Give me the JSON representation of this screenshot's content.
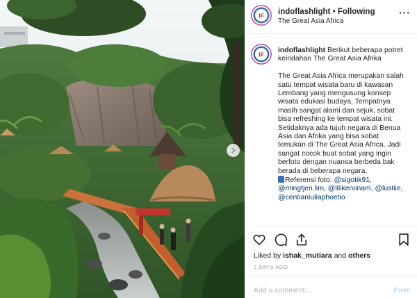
{
  "post": {
    "username": "indoflashlight",
    "separator": "•",
    "follow_label": "Following",
    "location": "The Great Asia Africa",
    "more_label": "···"
  },
  "caption": {
    "username": "indoflashlight",
    "intro": "Berikut beberapa potret keindahan The Great Asia Afrika",
    "body_text": "The Great Asia Africa merupakan salah satu tempat wisata baru di kawasan Lembang yang mengusung konsep wisata edukasi budaya. Tempatnya masih sangat alami dan sejuk, sobat bisa refreshing ke tempat wisata ini. Setidaknya ada tujuh negara di Benua Asia dan Afrika yang bisa sobat temukan di The Great Asia Africa. Jadi sangat cocok buat sobat yang ingin berfoto dengan nuansa berbeda bak berada di beberapa negara.",
    "referensi_label": "Referensi foto:",
    "mentions": [
      "@sigotik91,",
      "@mingtjen.lim,",
      "@lilikervinam,",
      "@lustiie,",
      "@centianiuliaphoetio"
    ]
  },
  "likes": {
    "prefix": "Liked by",
    "user": "ishak_mutiara",
    "and": "and",
    "others": "others"
  },
  "timestamp": "2 DAYS AGO",
  "comment": {
    "placeholder": "Add a comment...",
    "post_label": "Post"
  },
  "icons": {
    "like": "heart-icon",
    "comment": "comment-icon",
    "share": "share-icon",
    "save": "bookmark-icon",
    "next": "chevron-right-icon"
  },
  "colors": {
    "text": "#262626",
    "muted": "#999999",
    "mention": "#003569",
    "post_disabled": "#b3dbff",
    "avatar_ring": "#c13584"
  }
}
